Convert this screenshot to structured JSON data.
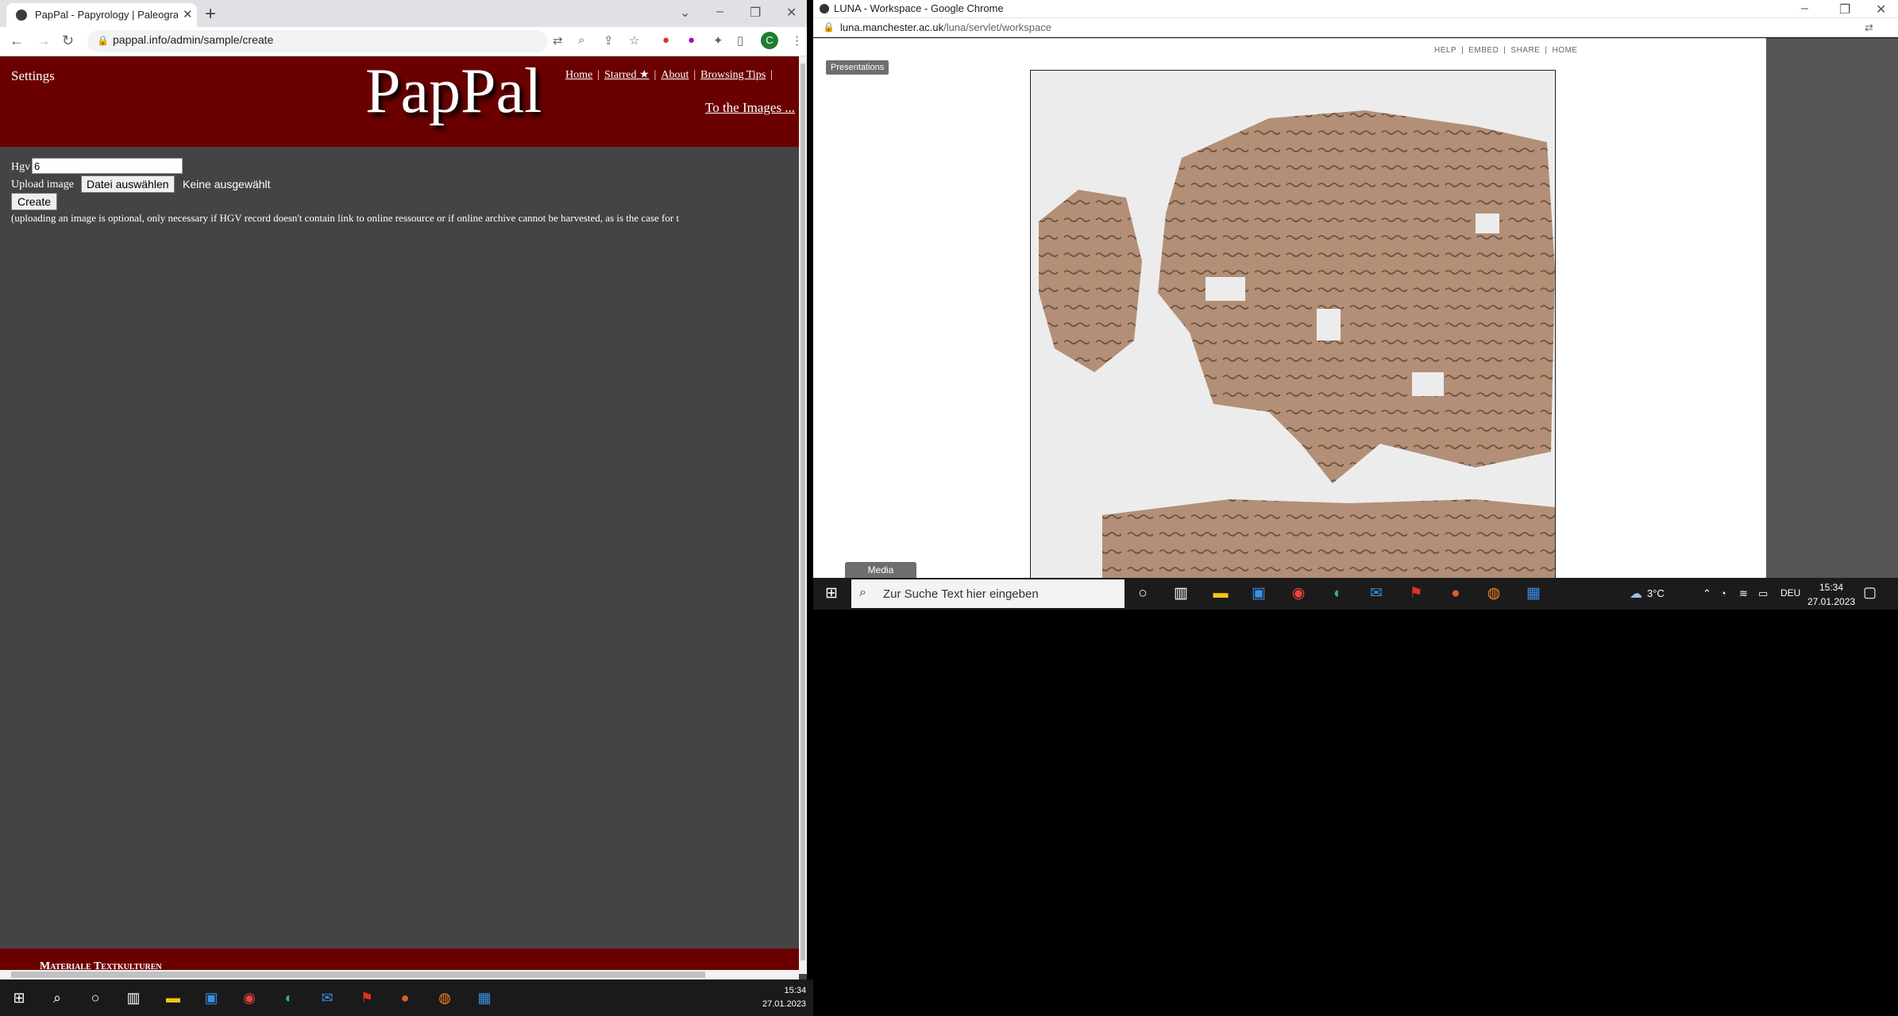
{
  "left_browser": {
    "tab_title": "PapPal - Papyrology | Paleograph",
    "url": "pappal.info/admin/sample/create",
    "avatar_letter": "C"
  },
  "pappal": {
    "settings": "Settings",
    "logo": "PapPal",
    "nav": [
      "Home",
      "Starred ★",
      "About",
      "Browsing Tips"
    ],
    "to_images": "To the Images ...",
    "hgv_label": "Hgv",
    "hgv_value": "6",
    "upload_label": "Upload image",
    "file_button": "Datei auswählen",
    "file_status": "Keine ausgewählt",
    "create_button": "Create",
    "upload_note": "(uploading an image is optional, only necessary if HGV record doesn't contain link to online ressource or if online archive cannot be harvested, as is the case for t",
    "footer": "Materiale Textkulturen"
  },
  "left_taskbar": {
    "time": "15:34",
    "date": "27.01.2023"
  },
  "right_browser": {
    "window_title": "LUNA - Workspace - Google Chrome",
    "url_host": "luna.manchester.ac.uk",
    "url_path": "/luna/servlet/workspace"
  },
  "luna": {
    "links": [
      "HELP",
      "EMBED",
      "SHARE",
      "HOME"
    ],
    "presentations": "Presentations",
    "media": "Media"
  },
  "right_taskbar": {
    "search_placeholder": "Zur Suche Text hier eingeben",
    "weather": "3°C",
    "lang": "DEU",
    "time": "15:34",
    "date": "27.01.2023"
  },
  "colors": {
    "pappal_red": "#6b0000",
    "page_bg": "#444444"
  }
}
